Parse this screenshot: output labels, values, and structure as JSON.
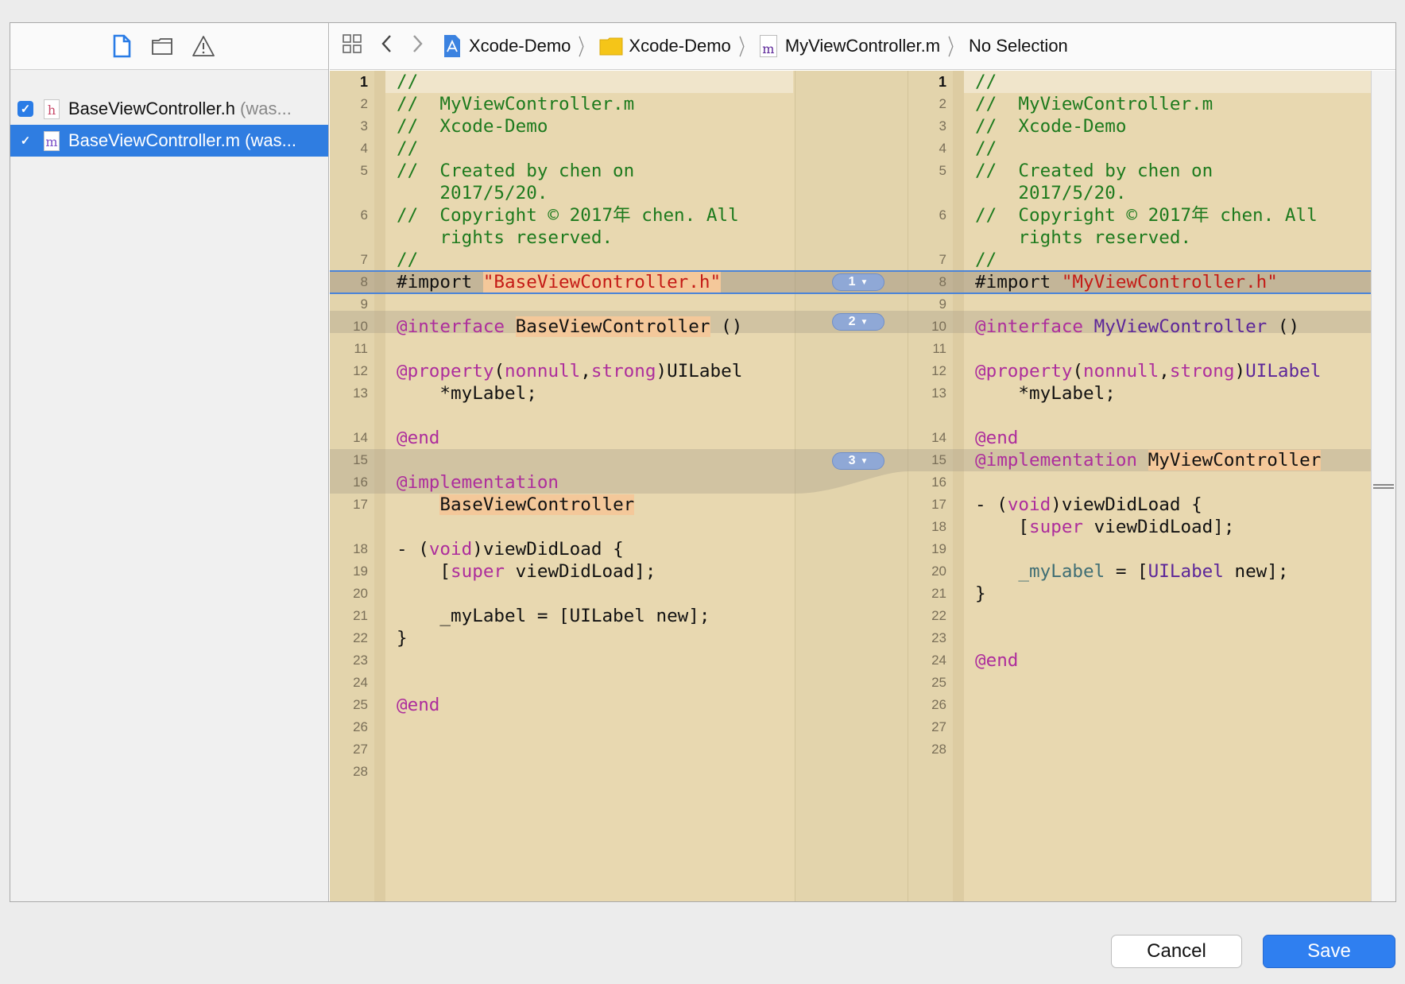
{
  "navigator": {
    "tabs": [
      "file-icon",
      "folder-icon",
      "warning-icon"
    ],
    "files": [
      {
        "name": "BaseViewController.h",
        "suffix": " (was...",
        "type_letter": "h",
        "checked": true,
        "selected": false
      },
      {
        "name": "BaseViewController.m",
        "suffix": " (was...",
        "type_letter": "m",
        "checked": true,
        "selected": true
      }
    ]
  },
  "jumpbar": {
    "project": "Xcode-Demo",
    "group": "Xcode-Demo",
    "file": "MyViewController.m",
    "file_letter": "m",
    "selection": "No Selection"
  },
  "diff": {
    "left_line_numbers": [
      "1",
      "2",
      "3",
      "4",
      "5",
      "",
      "6",
      "",
      "7",
      "8",
      "9",
      "10",
      "11",
      "12",
      "13",
      "",
      "14",
      "15",
      "16",
      "17",
      "",
      "18",
      "19",
      "20",
      "21",
      "22",
      "23",
      "24",
      "25",
      "26",
      "27",
      "28"
    ],
    "right_line_numbers": [
      "1",
      "2",
      "3",
      "4",
      "5",
      "",
      "6",
      "",
      "7",
      "8",
      "9",
      "10",
      "11",
      "12",
      "13",
      "",
      "14",
      "15",
      "16",
      "17",
      "18",
      "19",
      "20",
      "21",
      "22",
      "23",
      "24",
      "25",
      "26",
      "27",
      "28"
    ],
    "left": {
      "c2": "//  MyViewController.m",
      "c3": "//  Xcode-Demo",
      "c1": "//",
      "c5a": "//  Created by chen on",
      "c5b": "    2017/5/20.",
      "c6a": "//  Copyright © 2017年 chen. All",
      "c6b": "    rights reserved.",
      "imp_kw": "#import ",
      "imp_str": "\"BaseViewController.h\"",
      "iface_kw": "@interface",
      "iface_name": "BaseViewController",
      "iface_paren": " ()",
      "prop_kw": "@property",
      "prop_open": "(",
      "prop_attr1": "nonnull",
      "prop_comma": ",",
      "prop_attr2": "strong",
      "prop_close": ")UILabel",
      "prop_var": "    *myLabel;",
      "end": "@end",
      "impl_kw": "@implementation",
      "impl_name": "BaseViewController",
      "vdl_dash": "- (",
      "vdl_void": "void",
      "vdl_rest": ")viewDidLoad {",
      "sup_open": "    [",
      "sup_kw": "super",
      "sup_rest": " viewDidLoad];",
      "lbl": "    _myLabel = [UILabel new];",
      "brace": "}"
    },
    "right": {
      "c2": "//  MyViewController.m",
      "c3": "//  Xcode-Demo",
      "c1": "//",
      "c5a": "//  Created by chen on",
      "c5b": "    2017/5/20.",
      "c6a": "//  Copyright © 2017年 chen. All",
      "c6b": "    rights reserved.",
      "imp_kw": "#import ",
      "imp_str": "\"MyViewController.h\"",
      "iface_kw": "@interface",
      "iface_name": "MyViewController",
      "iface_paren": " ()",
      "prop_kw": "@property",
      "prop_open": "(",
      "prop_attr1": "nonnull",
      "prop_comma": ",",
      "prop_attr2": "strong",
      "prop_close": ")",
      "prop_cls": "UILabel",
      "prop_var": "    *myLabel;",
      "end": "@end",
      "impl_kw": "@implementation",
      "impl_name": "MyViewController",
      "vdl_dash": "- (",
      "vdl_void": "void",
      "vdl_rest": ")viewDidLoad {",
      "sup_open": "    [",
      "sup_kw": "super",
      "sup_rest": " viewDidLoad];",
      "lbl_ivar": "    _myLabel",
      "lbl_eq": " = [",
      "lbl_cls": "UILabel",
      "lbl_new": " new",
      "lbl_end": "];",
      "brace": "}"
    },
    "badges": [
      {
        "number": "1"
      },
      {
        "number": "2"
      },
      {
        "number": "3"
      }
    ]
  },
  "buttons": {
    "cancel": "Cancel",
    "save": "Save"
  },
  "colors": {
    "accent": "#2f7ff0",
    "comment": "#1d7a1d",
    "keyword": "#ad2d9c",
    "string": "#c41a16",
    "class": "#5c2699",
    "diff_background": "#e8d8b0"
  }
}
